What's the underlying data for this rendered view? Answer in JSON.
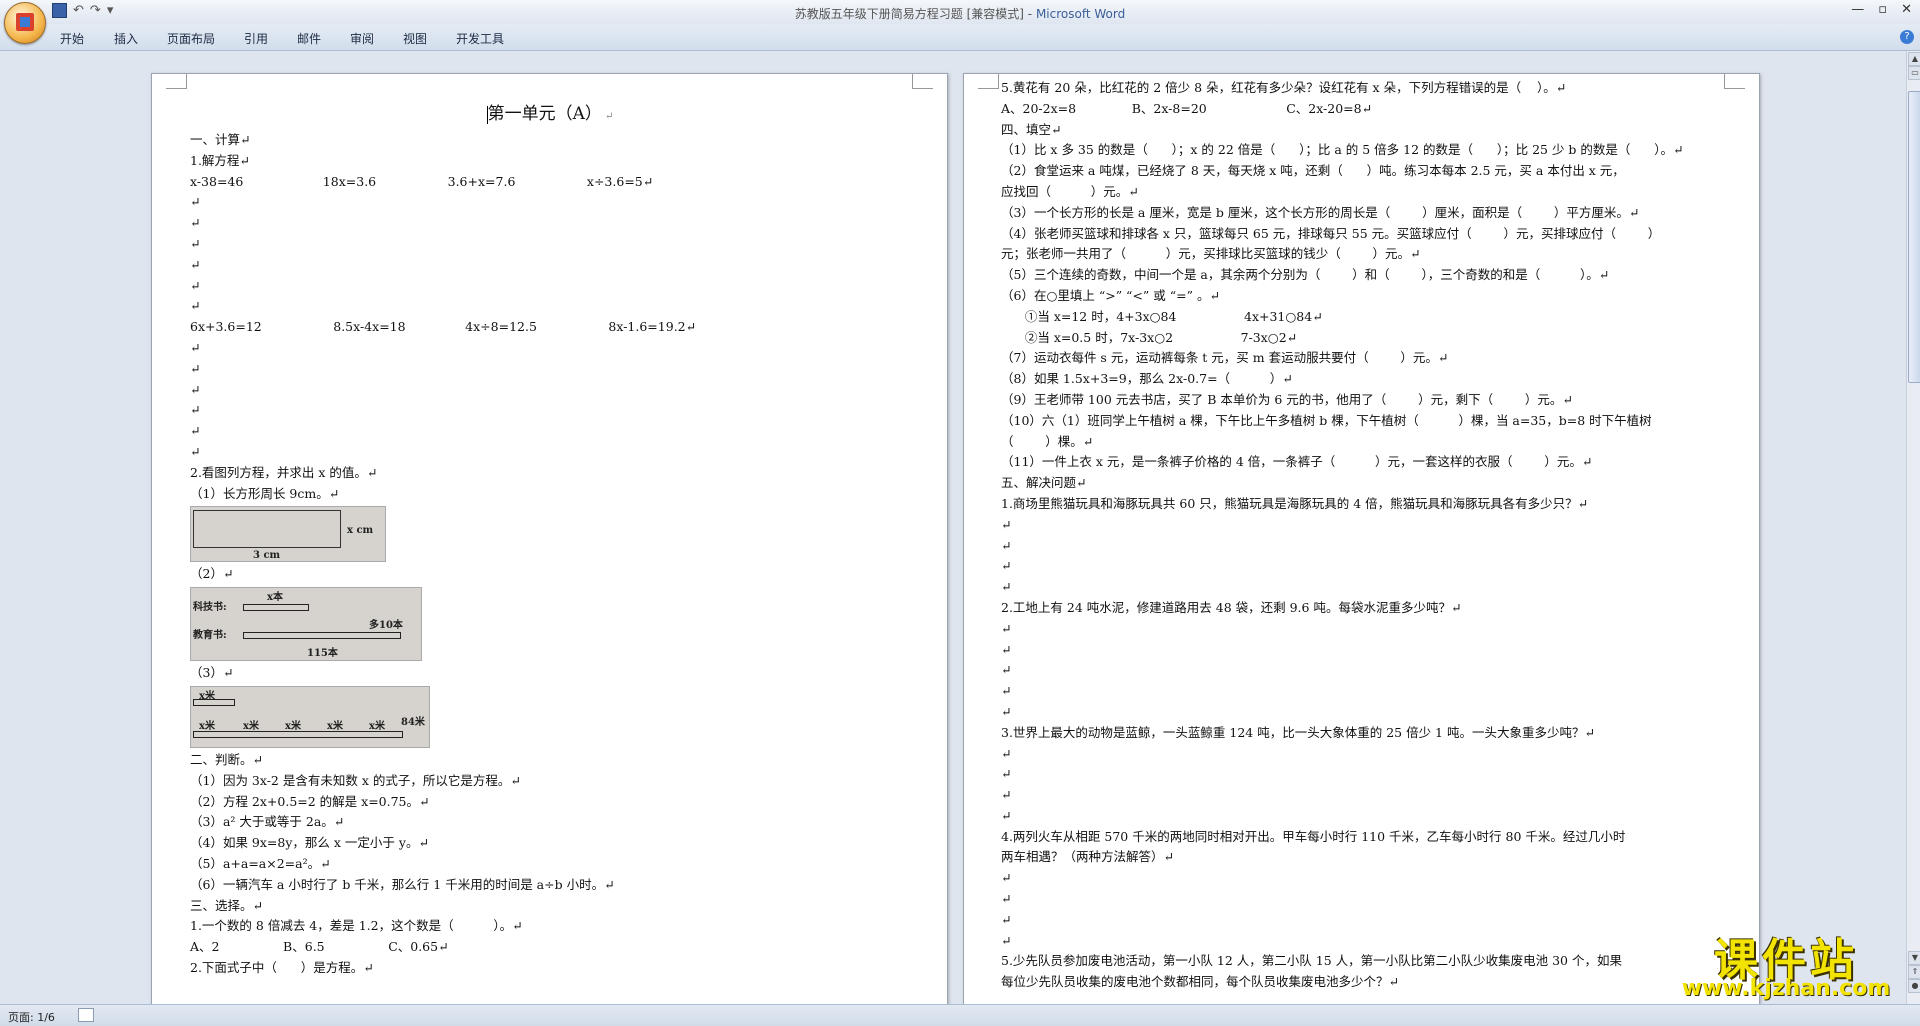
{
  "window": {
    "title_doc": "苏教版五年级下册简易方程习题 [兼容模式]",
    "title_sep": " - ",
    "title_app": "Microsoft Word",
    "controls": [
      "—",
      "▫",
      "✕"
    ]
  },
  "ribbon": {
    "tabs": [
      "开始",
      "插入",
      "页面布局",
      "引用",
      "邮件",
      "审阅",
      "视图",
      "开发工具"
    ],
    "help": "?"
  },
  "left_page": {
    "title": "第一单元（A）",
    "lines_a": [
      "一、计算↵",
      "1.解方程↵",
      "x-38=46                    18x=3.6                  3.6+x=7.6                  x÷3.6=5↵",
      "↵",
      "↵",
      "↵",
      "↵",
      "↵",
      "↵",
      "6x+3.6=12                  8.5x-4x=18               4x÷8=12.5                  8x-1.6=19.2↵",
      "↵",
      "↵",
      "↵",
      "↵",
      "↵",
      "↵",
      "2.看图列方程，并求出 x 的值。↵",
      "（1）长方形周长 9cm。↵"
    ],
    "fig1": {
      "left_label": "3 cm",
      "right_label": "x cm"
    },
    "q2_label": "（2）↵",
    "fig2": {
      "row1": "科技书:",
      "row2": "教育书:",
      "top": "x本",
      "diff": "多10本",
      "total": "115本"
    },
    "q3_label": "（3）↵",
    "fig3": {
      "top": "x米",
      "units": [
        "x米",
        "x米",
        "x米",
        "x米",
        "x米"
      ],
      "total": "84米"
    },
    "lines_b": [
      "二、判断。↵",
      "（1）因为 3x-2 是含有未知数 x 的式子，所以它是方程。↵",
      "（2）方程 2x+0.5=2 的解是 x=0.75。↵",
      "（3）a² 大于或等于 2a。↵",
      "（4）如果 9x=8y，那么 x 一定小于 y。↵",
      "（5）a+a=a×2=a²。↵",
      "（6）一辆汽车 a 小时行了 b 千米，那么行 1 千米用的时间是 a÷b 小时。↵",
      "三、选择。↵",
      "1.一个数的 8 倍减去 4，差是 1.2，这个数是（          ）。↵",
      "A、2                B、6.5                C、0.65↵",
      "2.下面式子中（      ）是方程。↵"
    ]
  },
  "right_page": {
    "lines": [
      "5.黄花有 20 朵，比红花的 2 倍少 8 朵，红花有多少朵？设红花有 x 朵，下列方程错误的是（    ）。↵",
      "A、20-2x=8              B、2x-8=20                    C、2x-20=8↵",
      "四、填空↵",
      "（1）比 x 多 35 的数是（      ）；x 的 22 倍是（      ）；比 a 的 5 倍多 12 的数是（      ）；比 25 少 b 的数是（      ）。↵",
      "（2）食堂运来 a 吨煤，已经烧了 8 天，每天烧 x 吨，还剩（      ）吨。练习本每本 2.5 元，买 a 本付出 x 元，",
      "应找回（          ）元。↵",
      "（3）一个长方形的长是 a 厘米，宽是 b 厘米，这个长方形的周长是（        ）厘米，面积是（        ）平方厘米。↵",
      "（4）张老师买篮球和排球各 x 只，篮球每只 65 元，排球每只 55 元。买篮球应付（        ）元，买排球应付（        ）",
      "元；张老师一共用了（          ）元，买排球比买篮球的钱少（        ）元。↵",
      "（5）三个连续的奇数，中间一个是 a，其余两个分别为（        ）和（        ），三个奇数的和是（          ）。↵",
      "（6）在○里填上 “>” “<” 或 “=” 。↵",
      "      ①当 x=12 时，4+3x○84                 4x+31○84↵",
      "      ②当 x=0.5 时，7x-3x○2                 7-3x○2↵",
      "（7）运动衣每件 s 元，运动裤每条 t 元，买 m 套运动服共要付（        ）元。↵",
      "（8）如果 1.5x+3=9，那么 2x-0.7=（          ）↵",
      "（9）王老师带 100 元去书店，买了 B 本单价为 6 元的书，他用了（        ）元，剩下（        ）元。↵",
      "（10）六（1）班同学上午植树 a 棵，下午比上午多植树 b 棵，下午植树（          ）棵，当 a=35，b=8 时下午植树",
      "（        ）棵。↵",
      "（11）一件上衣 x 元，是一条裤子价格的 4 倍，一条裤子（          ）元，一套这样的衣服（        ）元。↵",
      "五、解决问题↵",
      "1.商场里熊猫玩具和海豚玩具共 60 只，熊猫玩具是海豚玩具的 4 倍，熊猫玩具和海豚玩具各有多少只？↵",
      "↵",
      "↵",
      "↵",
      "↵",
      "2.工地上有 24 吨水泥，修建道路用去 48 袋，还剩 9.6 吨。每袋水泥重多少吨？↵",
      "↵",
      "↵",
      "↵",
      "↵",
      "↵",
      "3.世界上最大的动物是蓝鲸，一头蓝鲸重 124 吨，比一头大象体重的 25 倍少 1 吨。一头大象重多少吨？↵",
      "↵",
      "↵",
      "↵",
      "↵",
      "4.两列火车从相距 570 千米的两地同时相对开出。甲车每小时行 110 千米，乙车每小时行 80 千米。经过几小时",
      "两车相遇？（两种方法解答）↵",
      "↵",
      "↵",
      "↵",
      "↵",
      "5.少先队员参加废电池活动，第一小队 12 人，第二小队 15 人，第一小队比第二小队少收集废电池 30 个，如果",
      "每位少先队员收集的废电池个数都相同，每个队员收集废电池多少个？↵"
    ]
  },
  "status": {
    "page": "页面: 1/6"
  },
  "watermark": {
    "cn": "课件站",
    "url": "www.kjzhan.com"
  },
  "colors": {
    "ribbon_bg": "#d3deec",
    "page_bg": "#ffffff",
    "watermark": "#f3e300",
    "app_title": "#3a5e9a"
  }
}
